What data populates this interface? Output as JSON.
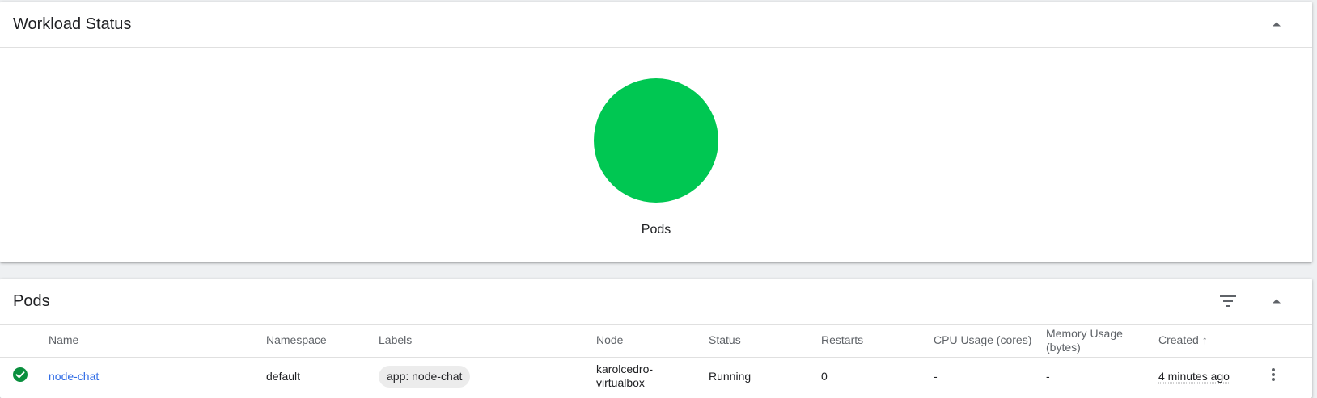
{
  "workload_status": {
    "title": "Workload Status",
    "chart_label": "Pods",
    "pie_color": "#00c752"
  },
  "pods": {
    "title": "Pods",
    "columns": {
      "name": "Name",
      "namespace": "Namespace",
      "labels": "Labels",
      "node": "Node",
      "status": "Status",
      "restarts": "Restarts",
      "cpu": "CPU Usage (cores)",
      "memory_line1": "Memory Usage",
      "memory_line2": "(bytes)",
      "created": "Created",
      "created_sort_icon": "arrow-up-icon"
    },
    "rows": [
      {
        "status_icon": "check-circle-icon",
        "name": "node-chat",
        "namespace": "default",
        "label": "app: node-chat",
        "node_line1": "karolcedro-",
        "node_line2": "virtualbox",
        "status": "Running",
        "restarts": "0",
        "cpu": "-",
        "memory": "-",
        "created": "4 minutes ago"
      }
    ]
  },
  "chart_data": {
    "type": "pie",
    "title": "",
    "categories": [
      "Running"
    ],
    "values": [
      1
    ],
    "colors": [
      "#00c752"
    ],
    "xlabel": "Pods"
  }
}
